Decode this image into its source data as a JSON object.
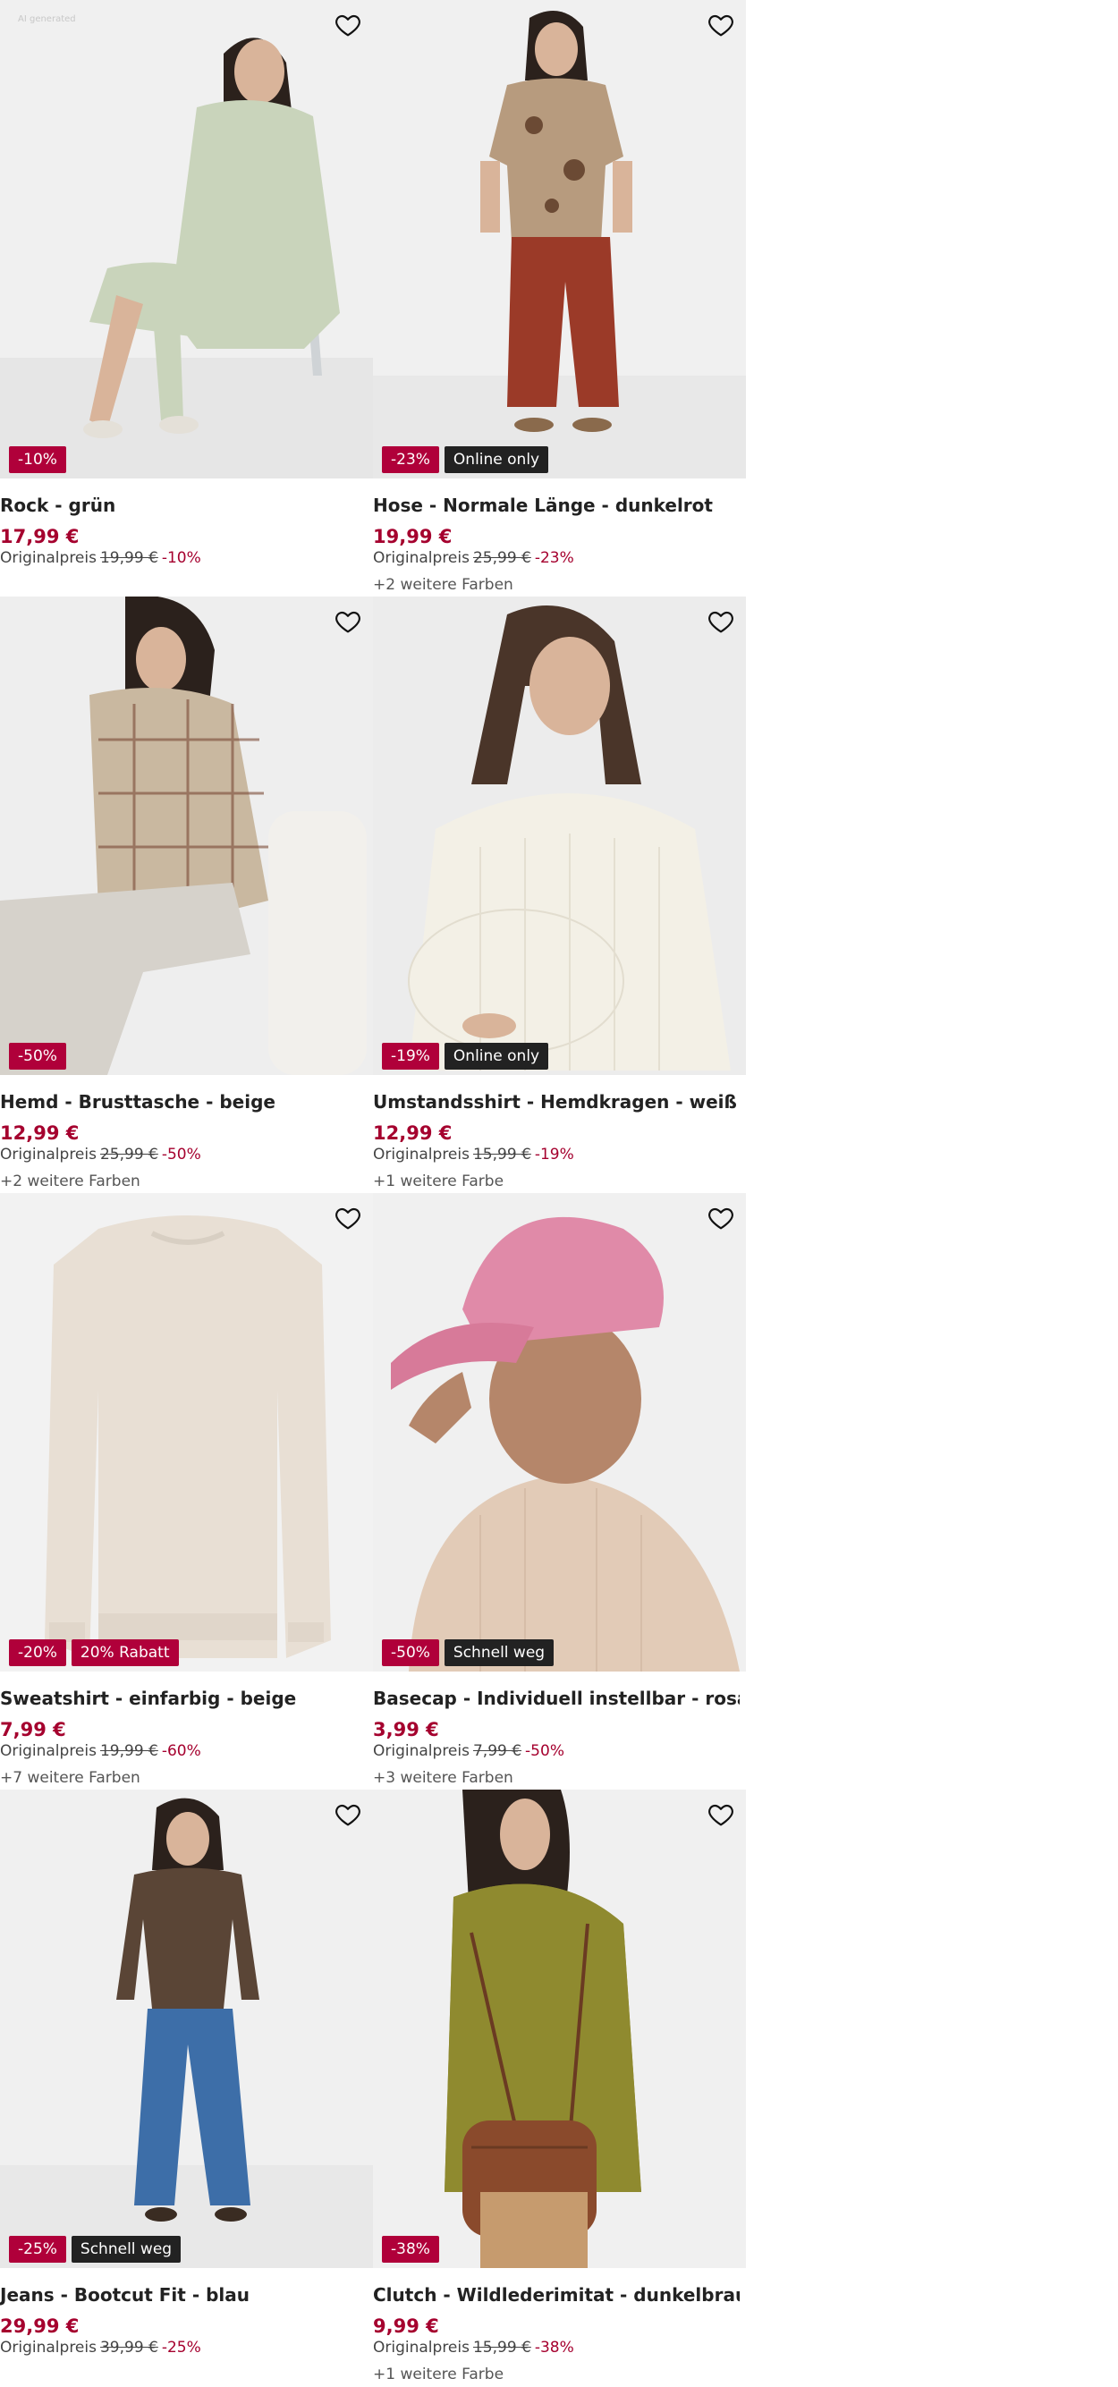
{
  "page": {
    "original_price_label": "Originalpreis"
  },
  "products": [
    {
      "title": "Rock - grün",
      "price": "17,99 €",
      "original_price": "19,99 €",
      "discount": "-10%",
      "badges": [
        "-10%"
      ],
      "more_colors": "",
      "watermark": "AI generated",
      "photo": {
        "bg": "#f0f0f0",
        "main": "#c9d4bb",
        "accent": "#3a2f2a"
      }
    },
    {
      "title": "Hose - Normale Länge - dunkelrot",
      "price": "19,99 €",
      "original_price": "25,99 €",
      "discount": "-23%",
      "badges": [
        "-23%",
        "Online only"
      ],
      "more_colors": "+2 weitere Farben",
      "photo": {
        "bg": "#f0f0f0",
        "main": "#9b3a28",
        "accent": "#b79b7e"
      }
    },
    {
      "title": "Hemd - Brusttasche - beige",
      "price": "12,99 €",
      "original_price": "25,99 €",
      "discount": "-50%",
      "badges": [
        "-50%"
      ],
      "more_colors": "+2 weitere Farben",
      "photo": {
        "bg": "#eeeeee",
        "main": "#c9b8a0",
        "accent": "#d6d2cb"
      }
    },
    {
      "title": "Umstandsshirt - Hemdkragen - weiß",
      "price": "12,99 €",
      "original_price": "15,99 €",
      "discount": "-19%",
      "badges": [
        "-19%",
        "Online only"
      ],
      "more_colors": "+1 weitere Farbe",
      "photo": {
        "bg": "#ececec",
        "main": "#f3f0e6",
        "accent": "#4a3529"
      }
    },
    {
      "title": "Sweatshirt - einfarbig - beige",
      "price": "7,99 €",
      "original_price": "19,99 €",
      "discount": "-60%",
      "badges": [
        "-20%",
        "20% Rabatt"
      ],
      "more_colors": "+7 weitere Farben",
      "photo": {
        "bg": "#f2f2f2",
        "main": "#e8dfd4",
        "accent": "#e8dfd4"
      }
    },
    {
      "title": "Basecap - Individuell instellbar - rosa",
      "price": "3,99 €",
      "original_price": "7,99 €",
      "discount": "-50%",
      "badges": [
        "-50%",
        "Schnell weg"
      ],
      "more_colors": "+3 weitere Farben",
      "photo": {
        "bg": "#f0f0f0",
        "main": "#e2cbb7",
        "accent": "#e08aa8"
      }
    },
    {
      "title": "Jeans - Bootcut Fit - blau",
      "price": "29,99 €",
      "original_price": "39,99 €",
      "discount": "-25%",
      "badges": [
        "-25%",
        "Schnell weg"
      ],
      "more_colors": "",
      "photo": {
        "bg": "#f0f0f0",
        "main": "#3d6ea8",
        "accent": "#5a4536"
      }
    },
    {
      "title": "Clutch - Wildlederimitat - dunkelbraun",
      "price": "9,99 €",
      "original_price": "15,99 €",
      "discount": "-38%",
      "badges": [
        "-38%"
      ],
      "more_colors": "+1 weitere Farbe",
      "photo": {
        "bg": "#f0f0f0",
        "main": "#8f8a2f",
        "accent": "#8a4a2c"
      }
    }
  ]
}
